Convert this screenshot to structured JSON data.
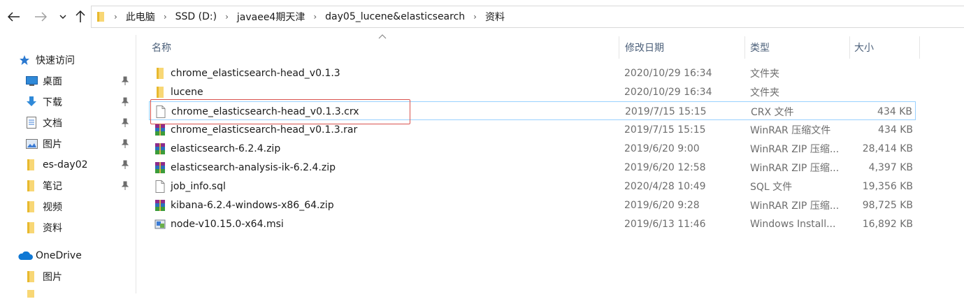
{
  "breadcrumb": [
    "此电脑",
    "SSD (D:)",
    "javaee4期天津",
    "day05_lucene&elasticsearch",
    "资料"
  ],
  "columns": {
    "name": "名称",
    "date": "修改日期",
    "type": "类型",
    "size": "大小"
  },
  "sidebar": {
    "quick_access": "快速访问",
    "items": [
      {
        "label": "桌面",
        "icon": "desktop-icon",
        "pinned": true
      },
      {
        "label": "下载",
        "icon": "download-icon",
        "pinned": true
      },
      {
        "label": "文档",
        "icon": "document-icon",
        "pinned": true
      },
      {
        "label": "图片",
        "icon": "picture-icon",
        "pinned": true
      },
      {
        "label": "es-day02",
        "icon": "folder-icon",
        "pinned": true
      },
      {
        "label": "笔记",
        "icon": "folder-icon",
        "pinned": true
      },
      {
        "label": "视频",
        "icon": "folder-icon",
        "pinned": false
      },
      {
        "label": "资料",
        "icon": "folder-icon",
        "pinned": false
      }
    ],
    "onedrive": "OneDrive",
    "onedrive_items": [
      {
        "label": "图片",
        "icon": "folder-icon"
      }
    ]
  },
  "files": [
    {
      "name": "chrome_elasticsearch-head_v0.1.3",
      "date": "2020/10/29 16:34",
      "type": "文件夹",
      "size": "",
      "icon": "folder-icon"
    },
    {
      "name": "lucene",
      "date": "2020/10/29 16:34",
      "type": "文件夹",
      "size": "",
      "icon": "folder-icon"
    },
    {
      "name": "chrome_elasticsearch-head_v0.1.3.crx",
      "date": "2019/7/15 15:15",
      "type": "CRX 文件",
      "size": "434 KB",
      "icon": "file-icon",
      "selected": true
    },
    {
      "name": "chrome_elasticsearch-head_v0.1.3.rar",
      "date": "2019/7/15 15:15",
      "type": "WinRAR 压缩文件",
      "size": "434 KB",
      "icon": "winrar-icon"
    },
    {
      "name": "elasticsearch-6.2.4.zip",
      "date": "2019/6/20 9:00",
      "type": "WinRAR ZIP 压缩...",
      "size": "28,414 KB",
      "icon": "winrar-icon"
    },
    {
      "name": "elasticsearch-analysis-ik-6.2.4.zip",
      "date": "2019/6/20 12:58",
      "type": "WinRAR ZIP 压缩...",
      "size": "4,397 KB",
      "icon": "winrar-icon"
    },
    {
      "name": "job_info.sql",
      "date": "2020/4/28 10:49",
      "type": "SQL 文件",
      "size": "19,356 KB",
      "icon": "file-icon"
    },
    {
      "name": "kibana-6.2.4-windows-x86_64.zip",
      "date": "2019/6/20 9:28",
      "type": "WinRAR ZIP 压缩...",
      "size": "98,725 KB",
      "icon": "winrar-icon"
    },
    {
      "name": "node-v10.15.0-x64.msi",
      "date": "2019/6/13 11:46",
      "type": "Windows Install...",
      "size": "16,892 KB",
      "icon": "msi-icon"
    }
  ],
  "colors": {
    "accent": "#0078d7",
    "folder": "#f8d775",
    "highlight_box": "#d9534f"
  }
}
